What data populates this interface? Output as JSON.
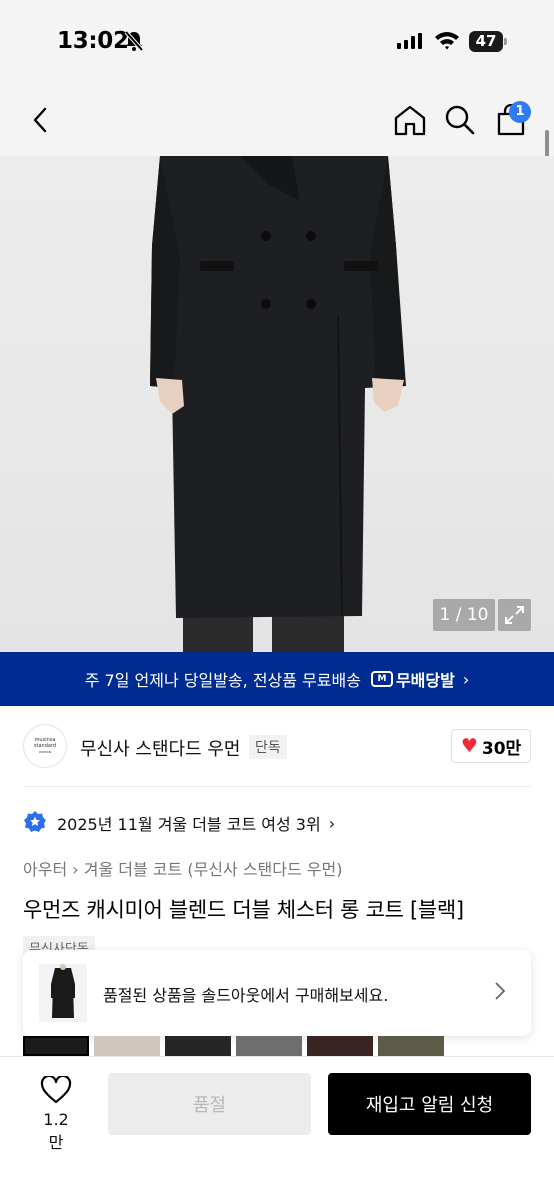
{
  "status_bar": {
    "time": "13:02",
    "battery": "47"
  },
  "nav": {
    "cart_count": "1"
  },
  "hero": {
    "counter": "1 / 10"
  },
  "banner": {
    "text": "주 7일 언제나 당일발송, 전상품 무료배송",
    "brand": "무배당발",
    "brand_mark": "M"
  },
  "brand": {
    "logo_lines": [
      "musinsa",
      "standard",
      "WOMAN"
    ],
    "name": "무신사 스탠다드 우먼",
    "exclusive": "단독",
    "likes": "30만"
  },
  "ranking": {
    "text": "2025년 11월 겨울 더블 코트 여성 3위"
  },
  "breadcrumb": {
    "category": "아우터",
    "subcategory": "겨울 더블 코트 (무신사 스탠다드 우먼)"
  },
  "product": {
    "title": "우먼즈 캐시미어 블렌드 더블 체스터 롱 코트 [블랙]",
    "tag": "무신사단독"
  },
  "soldout_card": {
    "message": "품절된 상품을 솔드아웃에서 구매해보세요."
  },
  "color_thumbs": [
    "#1b1b1b",
    "#cfc7bf",
    "#262626",
    "#6e6e6e",
    "#3a2424",
    "#5e5a48"
  ],
  "bottom": {
    "wish_count": "1.2만",
    "soldout_label": "품절",
    "restock_label": "재입고 알림 신청"
  }
}
